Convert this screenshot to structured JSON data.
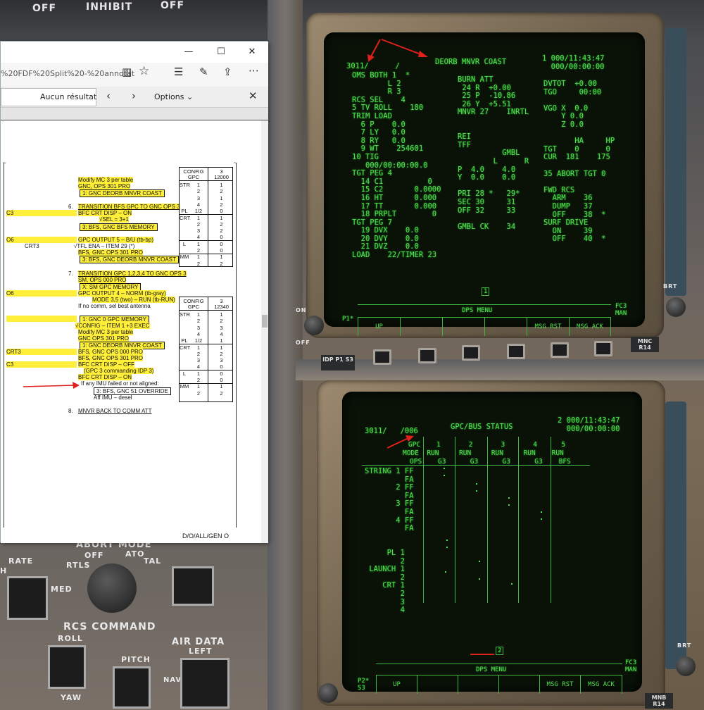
{
  "panel_top": {
    "off_left": "OFF",
    "inhibit": "INHIBIT",
    "off_right": "OFF"
  },
  "browser": {
    "url_fragment": "%20FDF%20Split%20-%20annotate",
    "find_result": "Aucun résultat",
    "options_label": "Options",
    "controls": {
      "minimize": "—",
      "maximize": "☐",
      "close": "✕"
    },
    "page_footer": "D/O/ALL/GEN O"
  },
  "doc": {
    "l1": "Modify MC 3 per table",
    "l2": "GNC, OPS 301 PRO",
    "l3": "1: GNC DEORB MNVR COAST",
    "s6_num": "6.",
    "s6": "TRANSITION BFS GPC TO GNC OPS 3",
    "c3": "C3",
    "l4": "BFC CRT DISP – ON",
    "l5": "√SEL = 3+1",
    "l6": "3: BFS, GNC BFS MEMORY",
    "o6": "O6",
    "l7": "GPC OUTPUT 5 – B/U (tb-bp)",
    "crt3": "CRT3",
    "l8": "√TFL ENA – ITEM 29 (*)",
    "l9": "BFS, GNC OPS 301 PRO",
    "l10": "3: BFS, GNC DEORB MNVR COAST",
    "s7_num": "7.",
    "s7": "TRANSITION GPC 1,2,3,4 TO GNC OPS 3",
    "l11": "SM, OPS 000 PRO",
    "l12": "X: SM GPC MEMORY",
    "o6b": "O6",
    "l13": "GPC OUTPUT 4 – NORM (tb-gray)",
    "l14": "MODE 3,5 (two) – RUN (tb-RUN)",
    "l15": "If no comm, sel best antenna",
    "l16": "1: GNC 0 GPC MEMORY",
    "l17": "√CONFIG – ITEM 1 +3 EXEC",
    "l18": "Modify MC 3 per table",
    "l19": "GNC OPS 301 PRO",
    "l20": "1: GNC DEORB MNVR COAST",
    "crt3b": "CRT3",
    "l21": "BFS, GNC OPS 000 PRO",
    "l22": "BFS, GNC OPS 301 PRO",
    "c3b": "C3",
    "l23": "BFC CRT DISP – OFF",
    "l24": "(GPC 3 commanding IDP 3)",
    "l25": "BFC CRT DISP – ON",
    "l26": "If any IMU failed or not aligned:",
    "l27": "3: BFS, GNC 51 OVERRIDE",
    "l28": "Aff IMU – desel",
    "s8_num": "8.",
    "s8": "MNVR BACK TO COMM ATT",
    "tilde": "~"
  },
  "table1": {
    "h1": "CONFIG",
    "h2": "GPC",
    "v1": "3",
    "v2": "12000",
    "rows": [
      [
        "STR",
        "1",
        "1"
      ],
      [
        "",
        "2",
        "2"
      ],
      [
        "",
        "3",
        "1"
      ],
      [
        "",
        "4",
        "2"
      ],
      [
        "PL",
        "1/2",
        "0"
      ],
      [
        "CRT",
        "1",
        "1"
      ],
      [
        "",
        "2",
        "2"
      ],
      [
        "",
        "3",
        "2"
      ],
      [
        "",
        "4",
        "0"
      ],
      [
        "L",
        "1",
        "0"
      ],
      [
        "",
        "2",
        "0"
      ],
      [
        "MM",
        "1",
        "1"
      ],
      [
        "",
        "2",
        "2"
      ]
    ]
  },
  "table2": {
    "h1": "CONFIG",
    "h2": "GPC",
    "v1": "3",
    "v2": "12340",
    "rows": [
      [
        "STR",
        "1",
        "1"
      ],
      [
        "",
        "2",
        "2"
      ],
      [
        "",
        "3",
        "3"
      ],
      [
        "",
        "4",
        "4"
      ],
      [
        "PL",
        "1/2",
        "1"
      ],
      [
        "CRT",
        "1",
        "1"
      ],
      [
        "",
        "2",
        "2"
      ],
      [
        "",
        "3",
        "3"
      ],
      [
        "",
        "4",
        "0"
      ],
      [
        "L",
        "1",
        "0"
      ],
      [
        "",
        "2",
        "0"
      ],
      [
        "MM",
        "1",
        "1"
      ],
      [
        "",
        "2",
        "2"
      ]
    ]
  },
  "crt1": {
    "header_left": "3011/      /",
    "title": "DEORB MNVR COAST",
    "header_right": "1 000/11:43:47\n  000/00:00:00",
    "left": "OMS BOTH 1  *\n        L 2\n        R 3\nRCS SEL    4\n5 TV ROLL    180\nTRIM LOAD\n  6 P    0.0\n  7 LY   0.0\n  8 RY   0.0\n  9 WT    254601\n10 TIG\n   000/00:00:00.0\nTGT PEG 4\n  14 C1          0\n  15 C2       0.0000\n  16 HT       0.000\n  17 TT       0.000\n  18 PRPLT        0\nTGT PEG 7\n  19 DVX    0.0\n  20 DVY    0.0\n  21 DVZ    0.0\nLOAD    22/TIMER 23",
    "mid": "BURN ATT\n 24 R  +0.00\n 25 P  -10.86\n 26 Y  +5.51\nMNVR 27    INRTL\n\n\nREI\nTFF\n          GMBL\n        L      R\nP  4.0    4.0\nY  0.0    0.0\n\nPRI 28 *   29*\nSEC 30     31\nOFF 32     33\n\nGMBL CK    34",
    "right": "DVTOT  +0.00\nTGO     00:00\n\nVGO X  0.0\n    Y 0.0\n    Z 0.0\n\n       HA     HP\nTGT    0      0\nCUR  181    175\n\n35 ABORT TGT 0\n\nFWD RCS\n  ARM    36\n  DUMP   37\n  OFF    38  *\nSURF DRIVE\n  ON     39\n  OFF    40  *",
    "page_box": "1",
    "dps_menu": "DPS MENU",
    "up": "UP",
    "msg_rst": "MSG RST",
    "msg_ack": "MSG ACK",
    "fc_man": "FC3\nMAN",
    "p1": "P1*",
    "idp_label": "IDP P1\nS3",
    "mnc_label": "MNC\nR14"
  },
  "crt2": {
    "header_left": "3011/   /006",
    "title": "GPC/BUS STATUS",
    "header_right": "2 000/11:43:47\n  000/00:00:00",
    "gpc_row": "GPC    1       2       3       4      5",
    "mode_row": "MODE  RUN     RUN     RUN     RUN    RUN",
    "ops_row": "OPS    G3      G3      G3      G3    BFS",
    "left": "STRING 1 FF\n         FA\n       2 FF\n         FA\n       3 FF\n         FA\n       4 FF\n         FA\n\n\n     PL 1\n        2\n LAUNCH 1\n        2\n    CRT 1\n        2\n        3\n        4",
    "page_box": "2",
    "dps_menu": "DPS MENU",
    "up": "UP",
    "msg_rst": "MSG RST",
    "msg_ack": "MSG ACK",
    "fc_man": "FC3\nMAN",
    "p2": "P2*\nS3",
    "mnb_label": "MNB\nR14"
  },
  "panel_lower": {
    "abort_mode": "ABORT MODE",
    "off": "OFF",
    "ato": "ATO",
    "tal": "TAL",
    "rtls": "RTLS",
    "rate": "RATE",
    "h": "H",
    "med": "MED",
    "rcs_command": "RCS COMMAND",
    "roll": "ROLL",
    "pitch": "PITCH",
    "yaw": "YAW",
    "air_data": "AIR DATA",
    "left": "LEFT",
    "nav": "NAV",
    "on": "ON",
    "off_sw": "OFF",
    "brt": "BRT"
  },
  "colors": {
    "crt_green": "#4fe04f",
    "highlight": "#ffef3a",
    "arrow_red": "#e0201a"
  }
}
